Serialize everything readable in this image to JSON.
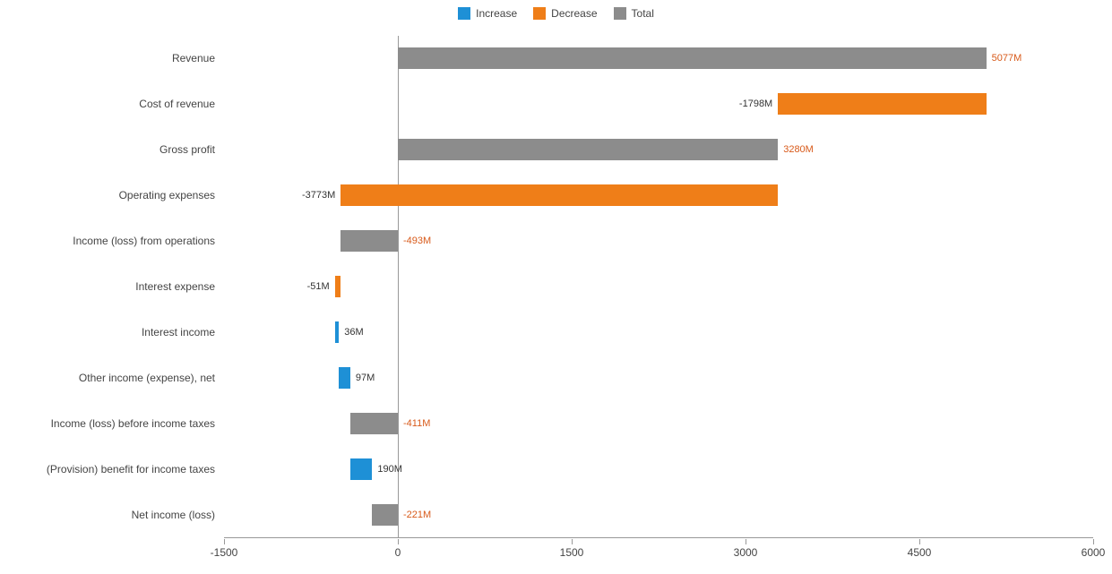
{
  "legend": {
    "increase": "Increase",
    "decrease": "Decrease",
    "total": "Total"
  },
  "colors": {
    "increase": "#1e90d6",
    "decrease": "#ef7e18",
    "total": "#8c8c8c",
    "label_pos": "#333333",
    "label_highlight": "#d85a1a"
  },
  "chart_data": {
    "type": "bar",
    "orientation": "horizontal-waterfall",
    "xlabel": "",
    "ylabel": "",
    "xlim": [
      -1500,
      6000
    ],
    "xticks": [
      -1500,
      0,
      1500,
      3000,
      4500,
      6000
    ],
    "categories": [
      "Revenue",
      "Cost of revenue",
      "Gross profit",
      "Operating expenses",
      "Income (loss) from operations",
      "Interest expense",
      "Interest income",
      "Other income (expense), net",
      "Income (loss) before income taxes",
      "(Provision) benefit for income taxes",
      "Net income (loss)"
    ],
    "series": [
      {
        "name": "Revenue",
        "kind": "total",
        "start": 0,
        "end": 5077,
        "label": "5077M",
        "label_color": "label_highlight",
        "label_side": "right"
      },
      {
        "name": "Cost of revenue",
        "kind": "decrease",
        "start": 5077,
        "end": 3280,
        "label": "-1798M",
        "label_color": "label_pos",
        "label_side": "left"
      },
      {
        "name": "Gross profit",
        "kind": "total",
        "start": 0,
        "end": 3280,
        "label": "3280M",
        "label_color": "label_highlight",
        "label_side": "right"
      },
      {
        "name": "Operating expenses",
        "kind": "decrease",
        "start": 3280,
        "end": -493,
        "label": "-3773M",
        "label_color": "label_pos",
        "label_side": "left"
      },
      {
        "name": "Income (loss) from operations",
        "kind": "total",
        "start": 0,
        "end": -493,
        "label": "-493M",
        "label_color": "label_highlight",
        "label_side": "right"
      },
      {
        "name": "Interest expense",
        "kind": "decrease",
        "start": -493,
        "end": -544,
        "label": "-51M",
        "label_color": "label_pos",
        "label_side": "left"
      },
      {
        "name": "Interest income",
        "kind": "increase",
        "start": -544,
        "end": -508,
        "label": "36M",
        "label_color": "label_pos",
        "label_side": "right"
      },
      {
        "name": "Other income (expense), net",
        "kind": "increase",
        "start": -508,
        "end": -411,
        "label": "97M",
        "label_color": "label_pos",
        "label_side": "right"
      },
      {
        "name": "Income (loss) before income taxes",
        "kind": "total",
        "start": 0,
        "end": -411,
        "label": "-411M",
        "label_color": "label_highlight",
        "label_side": "right"
      },
      {
        "name": "(Provision) benefit for income taxes",
        "kind": "increase",
        "start": -411,
        "end": -221,
        "label": "190M",
        "label_color": "label_pos",
        "label_side": "right"
      },
      {
        "name": "Net income (loss)",
        "kind": "total",
        "start": 0,
        "end": -221,
        "label": "-221M",
        "label_color": "label_highlight",
        "label_side": "right"
      }
    ]
  }
}
